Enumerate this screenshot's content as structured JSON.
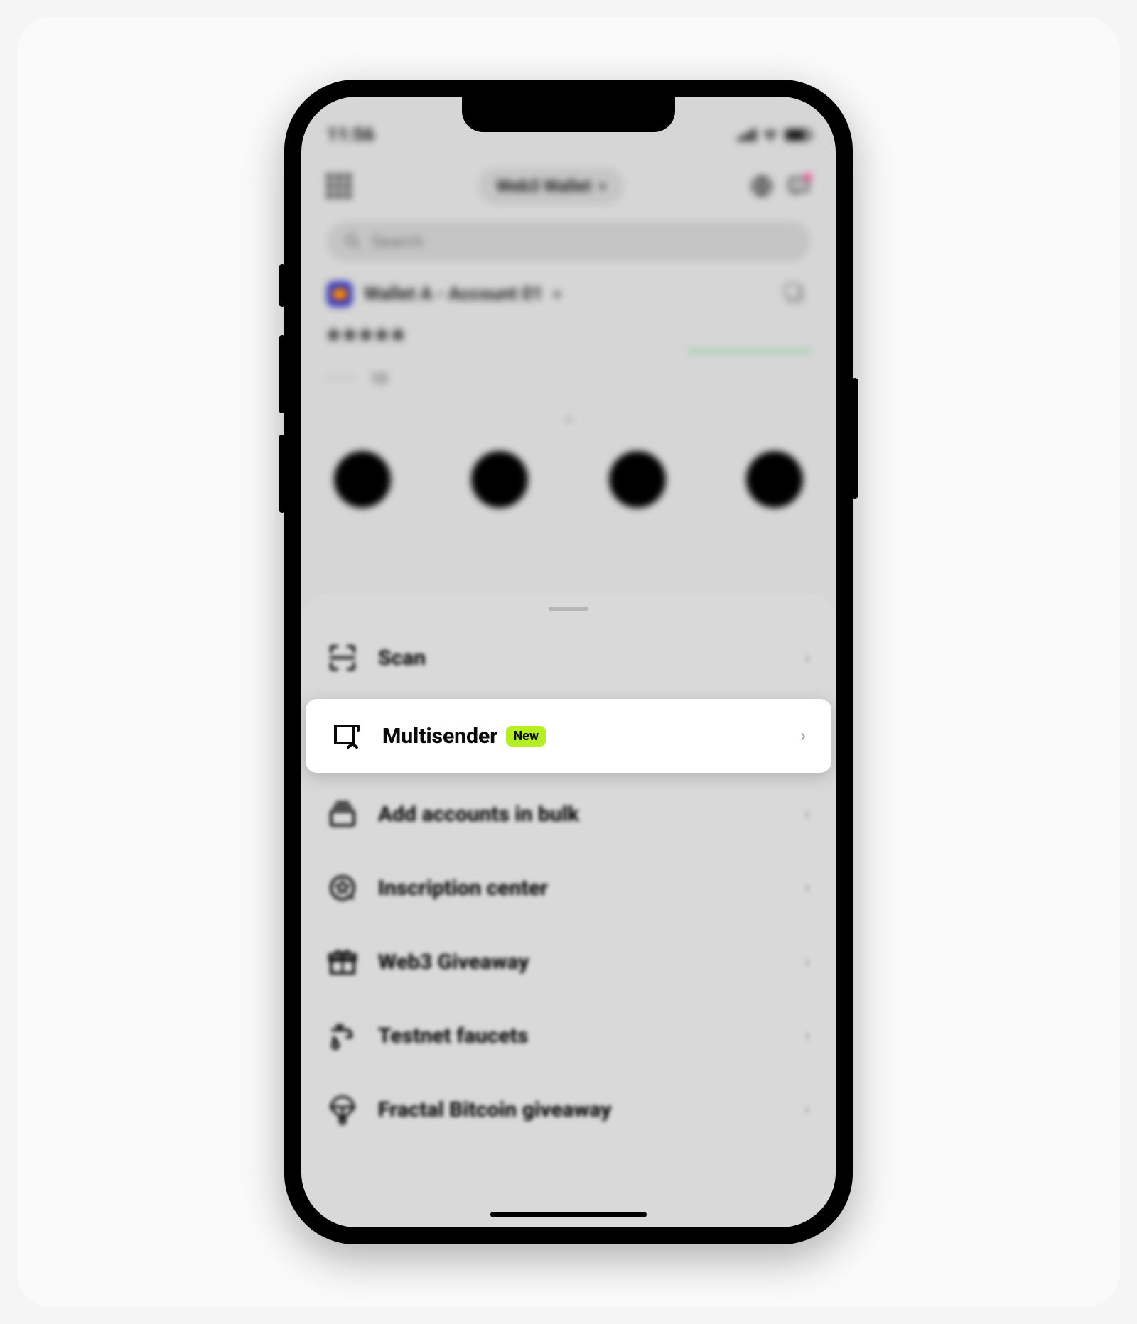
{
  "status": {
    "time": "11:56"
  },
  "header": {
    "wallet_selector_label": "Web3 Wallet"
  },
  "search": {
    "placeholder": "Search"
  },
  "account": {
    "label": "Wallet A - Account 01",
    "balance_masked": "*****",
    "pnl_masked": "·····",
    "period": "1D"
  },
  "sheet": {
    "items": [
      {
        "label": "Scan",
        "badge": null,
        "highlight": false
      },
      {
        "label": "Multisender",
        "badge": "New",
        "highlight": true
      },
      {
        "label": "Add accounts in bulk",
        "badge": null,
        "highlight": false
      },
      {
        "label": "Inscription center",
        "badge": null,
        "highlight": false
      },
      {
        "label": "Web3 Giveaway",
        "badge": null,
        "highlight": false
      },
      {
        "label": "Testnet faucets",
        "badge": null,
        "highlight": false
      },
      {
        "label": "Fractal Bitcoin giveaway",
        "badge": null,
        "highlight": false
      }
    ]
  }
}
